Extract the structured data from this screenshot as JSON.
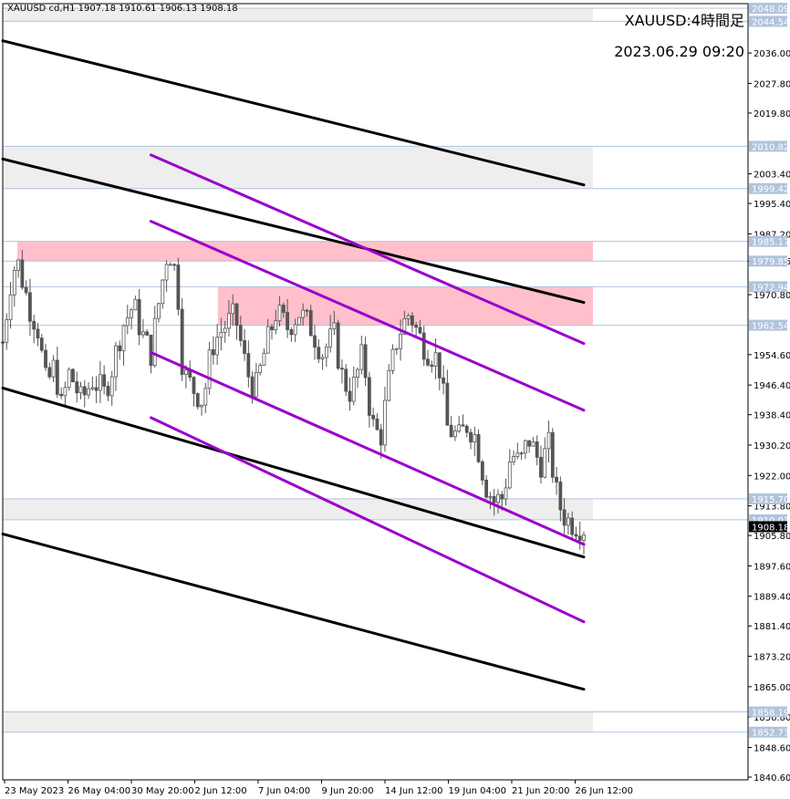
{
  "header": {
    "symbol_line": "XAUUSD cd,H1",
    "ohlc": "1907.18 1910.61 1906.13 1908.18"
  },
  "overlay": {
    "title": "XAUUSD:4時間足",
    "datetime": "2023.06.29 09:20"
  },
  "chart_data": {
    "type": "candlestick",
    "ylim": [
      1840.6,
      2048.09
    ],
    "y_ticks": [
      2036.0,
      2027.8,
      2019.8,
      2003.4,
      1995.4,
      1987.2,
      1979.85,
      1970.8,
      1954.6,
      1946.4,
      1938.4,
      1930.2,
      1922.0,
      1913.8,
      1905.8,
      1897.6,
      1889.4,
      1881.4,
      1873.2,
      1865.0,
      1856.8,
      1848.6,
      1840.6
    ],
    "x_labels": [
      "23 May 2023",
      "26 May 04:00",
      "30 May 20:00",
      "2 Jun 12:00",
      "7 Jun 04:00",
      "9 Jun 20:00",
      "14 Jun 12:00",
      "19 Jun 04:00",
      "21 Jun 20:00",
      "26 Jun 12:00"
    ],
    "price_levels": [
      {
        "value": 2048.09,
        "label": "2048.09",
        "highlight": true
      },
      {
        "value": 2044.54,
        "label": "2044.54",
        "highlight": true
      },
      {
        "value": 2010.82,
        "label": "2010.82",
        "highlight": true
      },
      {
        "value": 1999.42,
        "label": "1999.42",
        "highlight": true
      },
      {
        "value": 1985.17,
        "label": "1985.17",
        "highlight": true
      },
      {
        "value": 1979.85,
        "label": "1979.85",
        "highlight": true
      },
      {
        "value": 1972.94,
        "label": "1972.94",
        "highlight": true
      },
      {
        "value": 1962.54,
        "label": "1962.54",
        "highlight": true
      },
      {
        "value": 1915.7,
        "label": "1915.70",
        "highlight": true
      },
      {
        "value": 1910.03,
        "label": "1910.03",
        "highlight": true
      },
      {
        "value": 1908.18,
        "label": "1908.18",
        "current": true
      },
      {
        "value": 1858.19,
        "label": "1858.19",
        "highlight": true
      },
      {
        "value": 1852.73,
        "label": "1852.73",
        "highlight": true
      }
    ],
    "zones": [
      {
        "color": "#eeeeee",
        "top": 2048.09,
        "bottom": 2044.54
      },
      {
        "color": "#eeeeee",
        "top": 2010.82,
        "bottom": 1999.42
      },
      {
        "color": "#ffc0cb",
        "top": 1985.17,
        "bottom": 1979.85,
        "from_bar": 0.025
      },
      {
        "color": "#ffc0cb",
        "top": 1972.94,
        "bottom": 1962.54,
        "from_bar": 0.37
      },
      {
        "color": "#eeeeee",
        "top": 1915.7,
        "bottom": 1910.03
      },
      {
        "color": "#eeeeee",
        "top": 1858.19,
        "bottom": 1852.73
      }
    ],
    "trendlines": [
      {
        "color": "#000000",
        "from": [
          0.0,
          2039.3
        ],
        "to": [
          1.0,
          2000.4
        ]
      },
      {
        "color": "#000000",
        "from": [
          0.0,
          2007.4
        ],
        "to": [
          1.0,
          1968.7
        ]
      },
      {
        "color": "#000000",
        "from": [
          0.0,
          1945.6
        ],
        "to": [
          1.0,
          1900.0
        ]
      },
      {
        "color": "#000000",
        "from": [
          0.0,
          1906.2
        ],
        "to": [
          1.0,
          1864.3
        ]
      },
      {
        "color": "#9a00cc",
        "from": [
          0.255,
          2008.5
        ],
        "to": [
          1.0,
          1957.6
        ]
      },
      {
        "color": "#9a00cc",
        "from": [
          0.255,
          1990.6
        ],
        "to": [
          1.0,
          1939.6
        ]
      },
      {
        "color": "#9a00cc",
        "from": [
          0.255,
          1955.2
        ],
        "to": [
          1.0,
          1903.4
        ]
      },
      {
        "color": "#9a00cc",
        "from": [
          0.255,
          1937.6
        ],
        "to": [
          1.0,
          1882.5
        ]
      }
    ],
    "candles_path": [
      [
        0.0,
        1958
      ],
      [
        0.015,
        1976
      ],
      [
        0.025,
        1980
      ],
      [
        0.045,
        1968
      ],
      [
        0.06,
        1962
      ],
      [
        0.075,
        1946
      ],
      [
        0.09,
        1952
      ],
      [
        0.1,
        1940
      ],
      [
        0.115,
        1950
      ],
      [
        0.135,
        1942
      ],
      [
        0.155,
        1948
      ],
      [
        0.175,
        1944
      ],
      [
        0.19,
        1952
      ],
      [
        0.205,
        1962
      ],
      [
        0.225,
        1968
      ],
      [
        0.24,
        1960
      ],
      [
        0.255,
        1955
      ],
      [
        0.27,
        1970
      ],
      [
        0.285,
        1984
      ],
      [
        0.3,
        1975
      ],
      [
        0.31,
        1950
      ],
      [
        0.325,
        1946
      ],
      [
        0.345,
        1942
      ],
      [
        0.36,
        1957
      ],
      [
        0.38,
        1962
      ],
      [
        0.4,
        1965
      ],
      [
        0.42,
        1950
      ],
      [
        0.435,
        1945
      ],
      [
        0.45,
        1955
      ],
      [
        0.47,
        1966
      ],
      [
        0.49,
        1962
      ],
      [
        0.51,
        1966
      ],
      [
        0.53,
        1962
      ],
      [
        0.55,
        1955
      ],
      [
        0.57,
        1960
      ],
      [
        0.585,
        1948
      ],
      [
        0.6,
        1944
      ],
      [
        0.62,
        1955
      ],
      [
        0.635,
        1936
      ],
      [
        0.65,
        1932
      ],
      [
        0.665,
        1948
      ],
      [
        0.68,
        1960
      ],
      [
        0.7,
        1966
      ],
      [
        0.715,
        1960
      ],
      [
        0.73,
        1956
      ],
      [
        0.75,
        1953
      ],
      [
        0.765,
        1935
      ],
      [
        0.785,
        1932
      ],
      [
        0.8,
        1936
      ],
      [
        0.815,
        1932
      ],
      [
        0.83,
        1920
      ],
      [
        0.845,
        1915
      ],
      [
        0.86,
        1916
      ],
      [
        0.875,
        1928
      ],
      [
        0.89,
        1925
      ],
      [
        0.905,
        1932
      ],
      [
        0.925,
        1925
      ],
      [
        0.94,
        1930
      ],
      [
        0.955,
        1915
      ],
      [
        0.97,
        1910
      ],
      [
        0.985,
        1909
      ],
      [
        1.0,
        1908
      ]
    ]
  },
  "colors": {
    "background": "#ffffff",
    "axis": "#000000",
    "grey_zone": "#eeeeee",
    "pink_zone": "#ffc0cb",
    "purple": "#9a00cc",
    "level_line": "#b0c4de",
    "candle": "#555555"
  }
}
